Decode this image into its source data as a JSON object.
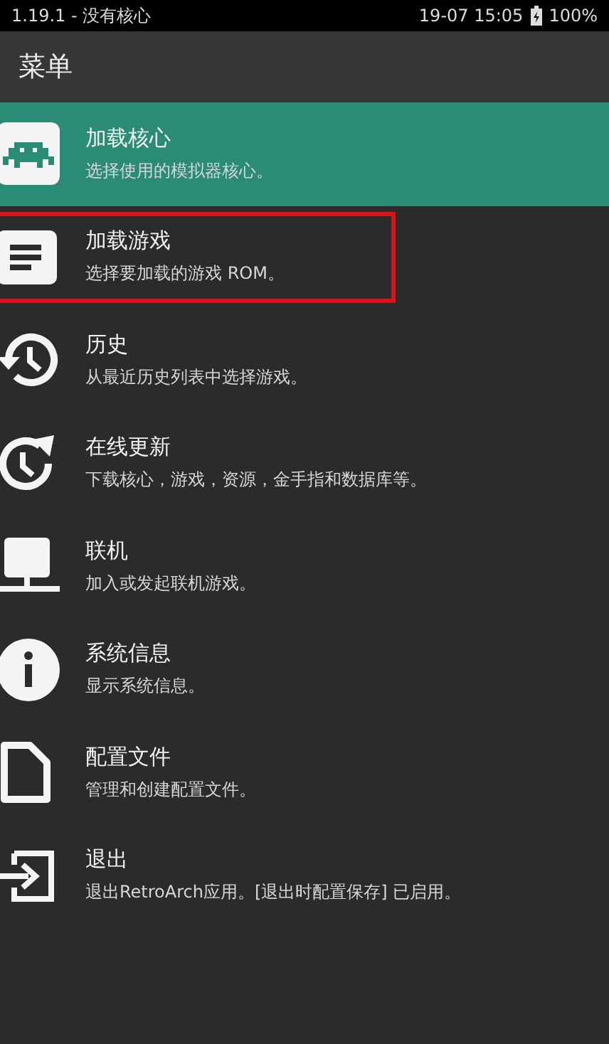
{
  "status_bar": {
    "left": "1.19.1 - 没有核心",
    "time": "19-07 15:05",
    "battery": "100%"
  },
  "header": {
    "title": "菜单"
  },
  "menu": [
    {
      "kind": "invader",
      "title": "加载核心",
      "subtitle": "选择使用的模拟器核心。",
      "selected": true,
      "outlined": false
    },
    {
      "kind": "document",
      "title": "加载游戏",
      "subtitle": "选择要加载的游戏 ROM。",
      "selected": false,
      "outlined": true
    },
    {
      "kind": "history",
      "title": "历史",
      "subtitle": "从最近历史列表中选择游戏。",
      "selected": false,
      "outlined": false
    },
    {
      "kind": "update",
      "title": "在线更新",
      "subtitle": "下载核心，游戏，资源，金手指和数据库等。",
      "selected": false,
      "outlined": false
    },
    {
      "kind": "network",
      "title": "联机",
      "subtitle": "加入或发起联机游戏。",
      "selected": false,
      "outlined": false
    },
    {
      "kind": "info",
      "title": "系统信息",
      "subtitle": "显示系统信息。",
      "selected": false,
      "outlined": false
    },
    {
      "kind": "file",
      "title": "配置文件",
      "subtitle": "管理和创建配置文件。",
      "selected": false,
      "outlined": false
    },
    {
      "kind": "exit",
      "title": "退出",
      "subtitle": "退出RetroArch应用。[退出时配置保存] 已启用。",
      "selected": false,
      "outlined": false
    }
  ]
}
